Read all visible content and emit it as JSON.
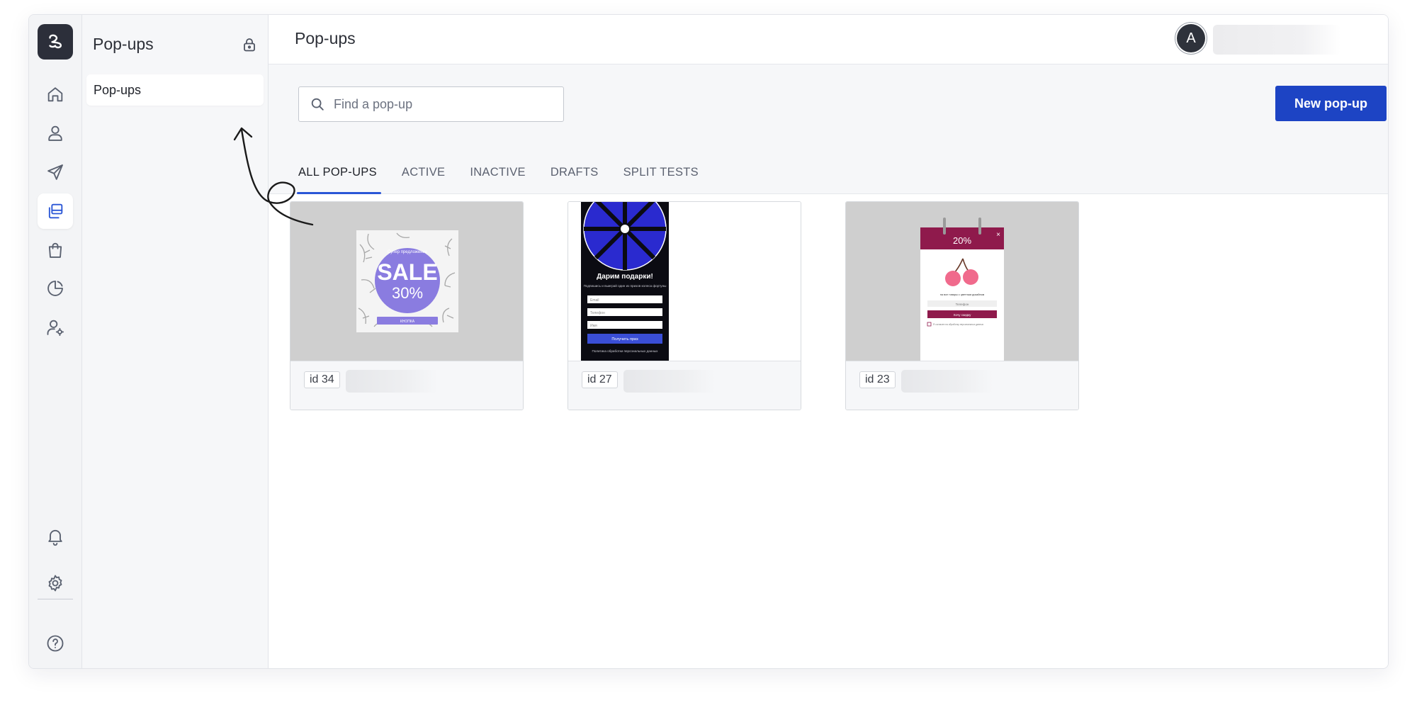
{
  "sidebar": {
    "title": "Pop-ups",
    "items": [
      {
        "label": "Pop-ups"
      }
    ]
  },
  "header": {
    "title": "Pop-ups",
    "avatar_initial": "A"
  },
  "search": {
    "placeholder": "Find a pop-up"
  },
  "toolbar": {
    "new_label": "New pop-up"
  },
  "tabs": [
    {
      "label": "ALL POP-UPS",
      "active": true
    },
    {
      "label": "ACTIVE",
      "active": false
    },
    {
      "label": "INACTIVE",
      "active": false
    },
    {
      "label": "DRAFTS",
      "active": false
    },
    {
      "label": "SPLIT TESTS",
      "active": false
    }
  ],
  "cards": [
    {
      "id_label": "id 34",
      "preview": {
        "caption": "Супер предложение",
        "headline": "SALE",
        "discount": "30%",
        "button": "КНОПКА"
      }
    },
    {
      "id_label": "id 27",
      "preview": {
        "headline": "Дарим подарки!",
        "subtitle": "Подпишись и выиграй один из призов колеса фортуны",
        "fields": [
          "Email",
          "Телефон",
          "Имя"
        ],
        "button": "Получить приз",
        "footer": "Политика обработки персональных данных"
      }
    },
    {
      "id_label": "id 23",
      "preview": {
        "badge": "20%",
        "text": "на все товары с цветным дизайном",
        "field": "Телефон",
        "button": "Хочу скидку",
        "consent": "Я согласен на обработку персональных данных"
      }
    }
  ],
  "colors": {
    "accent": "#1d44c4",
    "active_tab": "#2a56d6",
    "rail_bg": "#f3f4f6",
    "toolbar_bg": "#f6f7f9",
    "sale_circle": "#8a7ce0",
    "wheel_blue": "#2a2acf",
    "cherry_maroon": "#8f1a4c"
  },
  "icons": {
    "rail": [
      "home-icon",
      "user-icon",
      "send-icon",
      "popups-icon",
      "shopping-bag-icon",
      "pie-chart-icon",
      "user-settings-icon",
      "bell-icon",
      "gear-icon",
      "help-icon"
    ]
  }
}
